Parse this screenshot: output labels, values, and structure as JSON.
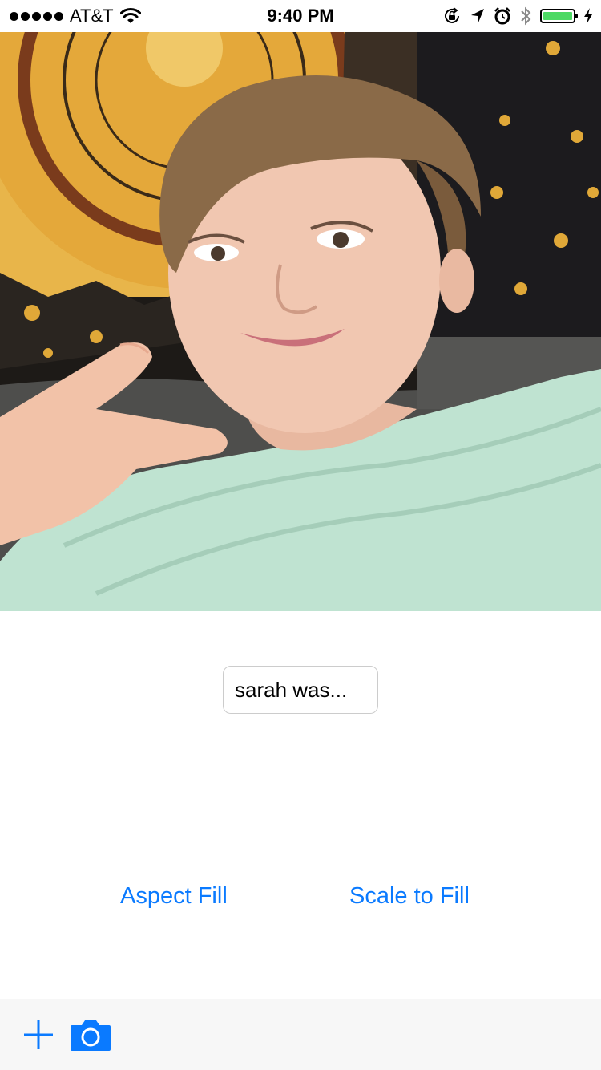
{
  "status_bar": {
    "carrier": "AT&T",
    "time": "9:40 PM",
    "signal_bars": 5,
    "battery_color": "#4cd964",
    "icons": [
      "wifi-icon",
      "rotation-lock-icon",
      "location-icon",
      "alarm-icon",
      "bluetooth-icon",
      "battery-icon",
      "charging-icon"
    ]
  },
  "photo": {
    "description_icon": "selfie-photo"
  },
  "caption": {
    "value": "sarah was..."
  },
  "buttons": {
    "aspect_fill": "Aspect Fill",
    "scale_to_fill": "Scale to Fill"
  },
  "toolbar": {
    "items": [
      "add-icon",
      "camera-icon"
    ],
    "accent": "#0a7aff"
  }
}
